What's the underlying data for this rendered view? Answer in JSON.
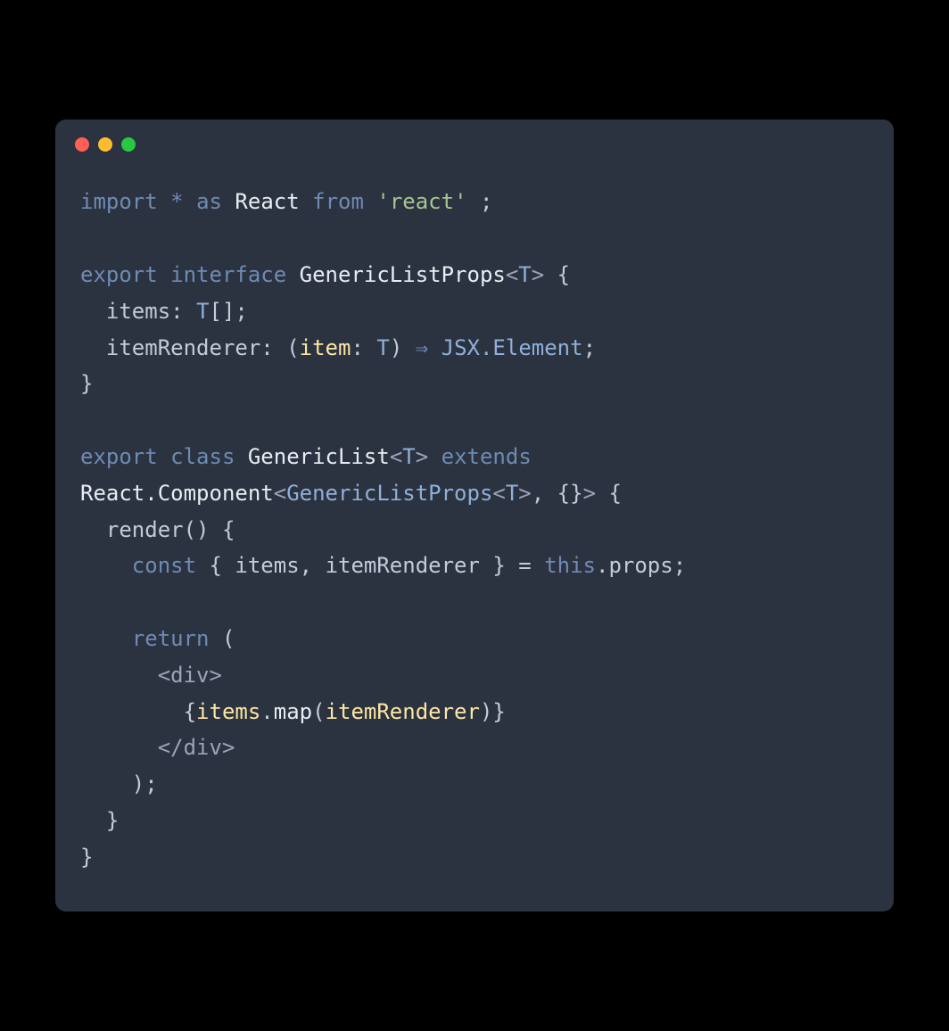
{
  "window": {
    "buttons": {
      "close": "red",
      "minimize": "yellow",
      "zoom": "green"
    }
  },
  "code": {
    "line1": {
      "import": "import",
      "star": "*",
      "as": "as",
      "react": "React",
      "from": "from",
      "reactstr": "'react'",
      "semi": " ;"
    },
    "line3": {
      "export": "export",
      "interface": "interface",
      "name": "GenericListProps",
      "lt": "<",
      "t": "T",
      "gt": ">",
      "brace": " {"
    },
    "line4": {
      "indent": "  ",
      "items": "items",
      "colon": ": ",
      "t": "T",
      "brackets": "[];"
    },
    "line5": {
      "indent": "  ",
      "renderer": "itemRenderer",
      "colon": ": (",
      "item": "item",
      "colon2": ": ",
      "t": "T",
      "paren": ") ",
      "arrow": "⇒",
      "sp": " ",
      "jsx": "JSX.Element",
      "semi": ";"
    },
    "line6": {
      "brace": "}"
    },
    "line8": {
      "export": "export",
      "class": "class",
      "name": "GenericList",
      "lt": "<",
      "t": "T",
      "gt": ">",
      "extends": "extends"
    },
    "line9": {
      "react": "React.Component",
      "lt": "<",
      "props": "GenericListProps",
      "lt2": "<",
      "t": "T",
      "gt2": ">",
      "comma": ", ",
      "empty": "{}",
      "gt": ">",
      "brace": " {"
    },
    "line10": {
      "indent": "  ",
      "render": "render",
      "parens": "()",
      "brace": " {"
    },
    "line11": {
      "indent": "    ",
      "const": "const",
      "brace": " { ",
      "items": "items",
      "comma": ", ",
      "renderer": "itemRenderer",
      "brace2": " } = ",
      "this": "this",
      "dot": ".",
      "props": "props",
      "semi": ";"
    },
    "line13": {
      "indent": "    ",
      "return": "return",
      "paren": " ("
    },
    "line14": {
      "indent": "      ",
      "lt": "<",
      "div": "div",
      "gt": ">"
    },
    "line15": {
      "indent": "        ",
      "brace": "{",
      "items": "items",
      "dot": ".",
      "map": "map",
      "paren": "(",
      "renderer": "itemRenderer",
      "paren2": ")",
      "brace2": "}"
    },
    "line16": {
      "indent": "      ",
      "lt": "</",
      "div": "div",
      "gt": ">"
    },
    "line17": {
      "indent": "    ",
      "paren": ");"
    },
    "line18": {
      "indent": "  ",
      "brace": "}"
    },
    "line19": {
      "brace": "}"
    }
  }
}
